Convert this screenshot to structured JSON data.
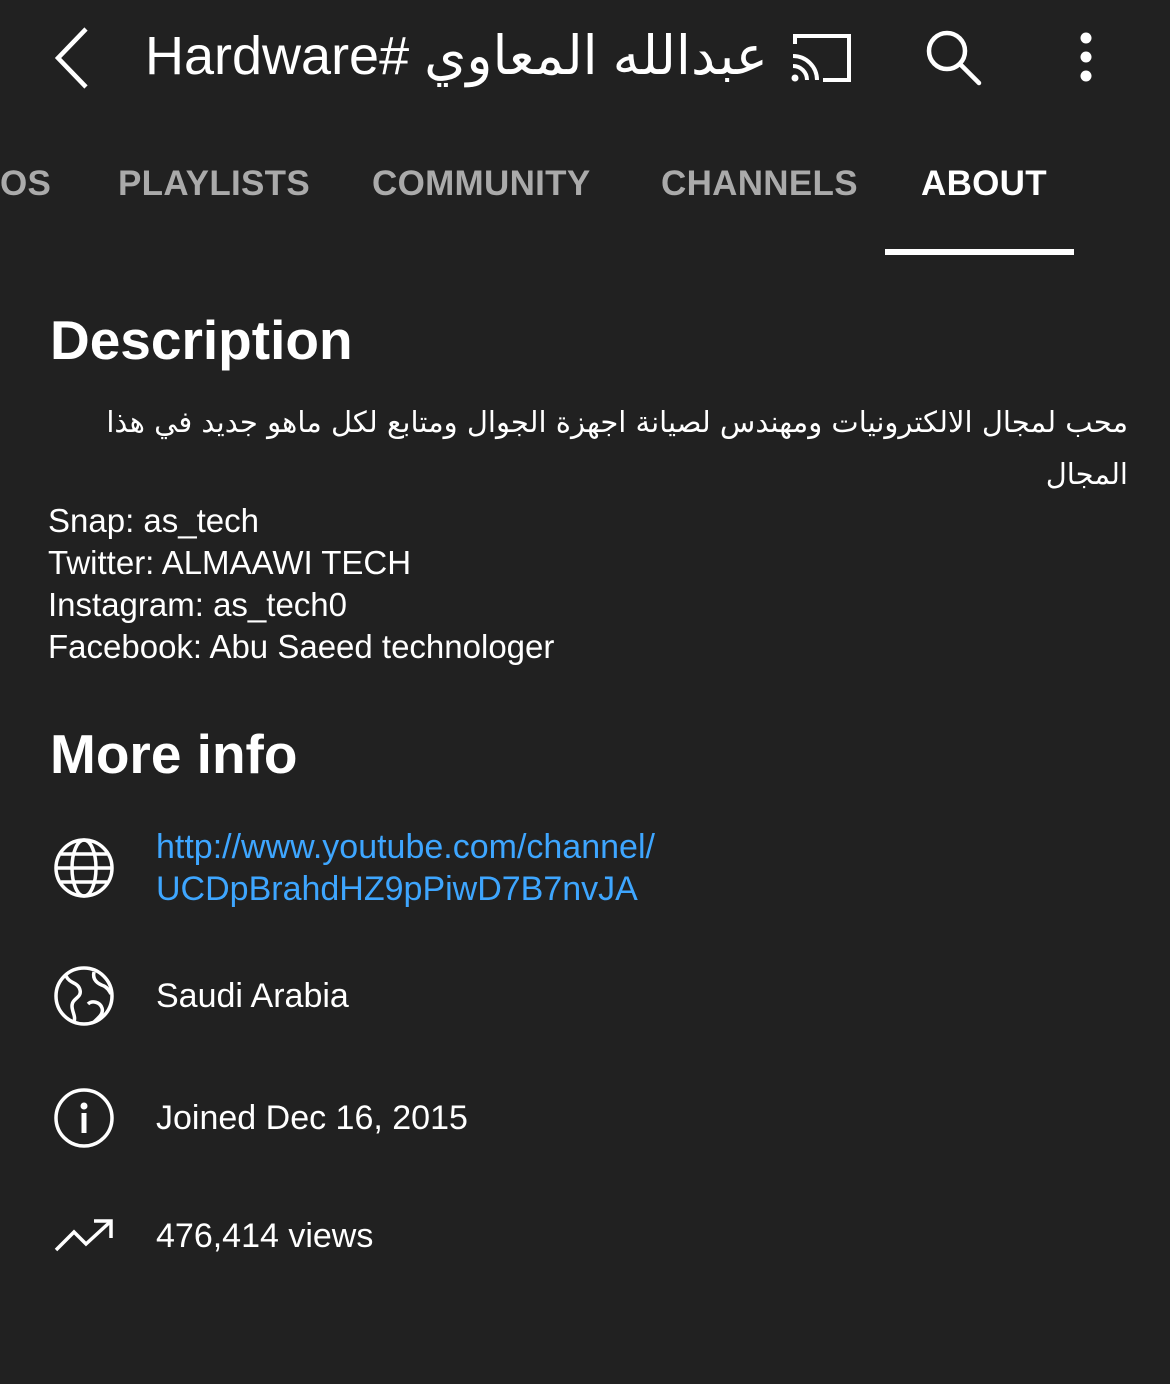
{
  "header": {
    "title": "عبدالله المعاوي #Hardware",
    "back_icon": "back-arrow-icon",
    "cast_icon": "cast-icon",
    "search_icon": "search-icon",
    "more_icon": "more-vert-icon"
  },
  "tabs": [
    {
      "label": "OS",
      "active": false
    },
    {
      "label": "PLAYLISTS",
      "active": false
    },
    {
      "label": "COMMUNITY",
      "active": false
    },
    {
      "label": "CHANNELS",
      "active": false
    },
    {
      "label": "ABOUT",
      "active": true
    }
  ],
  "description": {
    "heading": "Description",
    "arabic_text": "محب لمجال الالكترونيات ومهندس لصيانة اجهزة الجوال ومتابع لكل ماهو جديد في هذا المجال",
    "lines": [
      "Snap: as_tech",
      "Twitter: ALMAAWI TECH",
      "Instagram: as_tech0",
      "Facebook: Abu Saeed technologer"
    ]
  },
  "more_info": {
    "heading": "More info",
    "link_line1": "http://www.youtube.com/channel/",
    "link_line2": "UCDpBrahdHZ9pPiwD7B7nvJA",
    "country": "Saudi Arabia",
    "joined": "Joined Dec 16, 2015",
    "views": "476,414 views"
  },
  "colors": {
    "background": "#212121",
    "text": "#ffffff",
    "inactive_tab": "#aaaaaa",
    "link": "#3ea6ff"
  }
}
